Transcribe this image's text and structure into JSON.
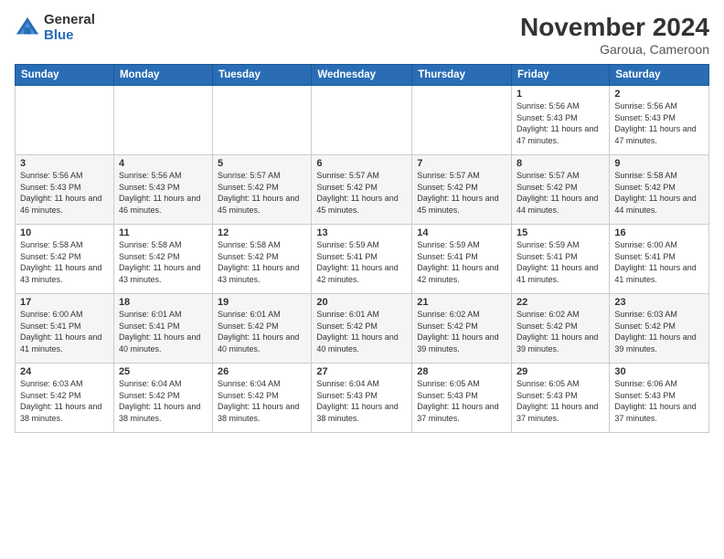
{
  "logo": {
    "general": "General",
    "blue": "Blue"
  },
  "header": {
    "month": "November 2024",
    "location": "Garoua, Cameroon"
  },
  "weekdays": [
    "Sunday",
    "Monday",
    "Tuesday",
    "Wednesday",
    "Thursday",
    "Friday",
    "Saturday"
  ],
  "weeks": [
    [
      {
        "day": "",
        "info": ""
      },
      {
        "day": "",
        "info": ""
      },
      {
        "day": "",
        "info": ""
      },
      {
        "day": "",
        "info": ""
      },
      {
        "day": "",
        "info": ""
      },
      {
        "day": "1",
        "info": "Sunrise: 5:56 AM\nSunset: 5:43 PM\nDaylight: 11 hours and 47 minutes."
      },
      {
        "day": "2",
        "info": "Sunrise: 5:56 AM\nSunset: 5:43 PM\nDaylight: 11 hours and 47 minutes."
      }
    ],
    [
      {
        "day": "3",
        "info": "Sunrise: 5:56 AM\nSunset: 5:43 PM\nDaylight: 11 hours and 46 minutes."
      },
      {
        "day": "4",
        "info": "Sunrise: 5:56 AM\nSunset: 5:43 PM\nDaylight: 11 hours and 46 minutes."
      },
      {
        "day": "5",
        "info": "Sunrise: 5:57 AM\nSunset: 5:42 PM\nDaylight: 11 hours and 45 minutes."
      },
      {
        "day": "6",
        "info": "Sunrise: 5:57 AM\nSunset: 5:42 PM\nDaylight: 11 hours and 45 minutes."
      },
      {
        "day": "7",
        "info": "Sunrise: 5:57 AM\nSunset: 5:42 PM\nDaylight: 11 hours and 45 minutes."
      },
      {
        "day": "8",
        "info": "Sunrise: 5:57 AM\nSunset: 5:42 PM\nDaylight: 11 hours and 44 minutes."
      },
      {
        "day": "9",
        "info": "Sunrise: 5:58 AM\nSunset: 5:42 PM\nDaylight: 11 hours and 44 minutes."
      }
    ],
    [
      {
        "day": "10",
        "info": "Sunrise: 5:58 AM\nSunset: 5:42 PM\nDaylight: 11 hours and 43 minutes."
      },
      {
        "day": "11",
        "info": "Sunrise: 5:58 AM\nSunset: 5:42 PM\nDaylight: 11 hours and 43 minutes."
      },
      {
        "day": "12",
        "info": "Sunrise: 5:58 AM\nSunset: 5:42 PM\nDaylight: 11 hours and 43 minutes."
      },
      {
        "day": "13",
        "info": "Sunrise: 5:59 AM\nSunset: 5:41 PM\nDaylight: 11 hours and 42 minutes."
      },
      {
        "day": "14",
        "info": "Sunrise: 5:59 AM\nSunset: 5:41 PM\nDaylight: 11 hours and 42 minutes."
      },
      {
        "day": "15",
        "info": "Sunrise: 5:59 AM\nSunset: 5:41 PM\nDaylight: 11 hours and 41 minutes."
      },
      {
        "day": "16",
        "info": "Sunrise: 6:00 AM\nSunset: 5:41 PM\nDaylight: 11 hours and 41 minutes."
      }
    ],
    [
      {
        "day": "17",
        "info": "Sunrise: 6:00 AM\nSunset: 5:41 PM\nDaylight: 11 hours and 41 minutes."
      },
      {
        "day": "18",
        "info": "Sunrise: 6:01 AM\nSunset: 5:41 PM\nDaylight: 11 hours and 40 minutes."
      },
      {
        "day": "19",
        "info": "Sunrise: 6:01 AM\nSunset: 5:42 PM\nDaylight: 11 hours and 40 minutes."
      },
      {
        "day": "20",
        "info": "Sunrise: 6:01 AM\nSunset: 5:42 PM\nDaylight: 11 hours and 40 minutes."
      },
      {
        "day": "21",
        "info": "Sunrise: 6:02 AM\nSunset: 5:42 PM\nDaylight: 11 hours and 39 minutes."
      },
      {
        "day": "22",
        "info": "Sunrise: 6:02 AM\nSunset: 5:42 PM\nDaylight: 11 hours and 39 minutes."
      },
      {
        "day": "23",
        "info": "Sunrise: 6:03 AM\nSunset: 5:42 PM\nDaylight: 11 hours and 39 minutes."
      }
    ],
    [
      {
        "day": "24",
        "info": "Sunrise: 6:03 AM\nSunset: 5:42 PM\nDaylight: 11 hours and 38 minutes."
      },
      {
        "day": "25",
        "info": "Sunrise: 6:04 AM\nSunset: 5:42 PM\nDaylight: 11 hours and 38 minutes."
      },
      {
        "day": "26",
        "info": "Sunrise: 6:04 AM\nSunset: 5:42 PM\nDaylight: 11 hours and 38 minutes."
      },
      {
        "day": "27",
        "info": "Sunrise: 6:04 AM\nSunset: 5:43 PM\nDaylight: 11 hours and 38 minutes."
      },
      {
        "day": "28",
        "info": "Sunrise: 6:05 AM\nSunset: 5:43 PM\nDaylight: 11 hours and 37 minutes."
      },
      {
        "day": "29",
        "info": "Sunrise: 6:05 AM\nSunset: 5:43 PM\nDaylight: 11 hours and 37 minutes."
      },
      {
        "day": "30",
        "info": "Sunrise: 6:06 AM\nSunset: 5:43 PM\nDaylight: 11 hours and 37 minutes."
      }
    ]
  ]
}
